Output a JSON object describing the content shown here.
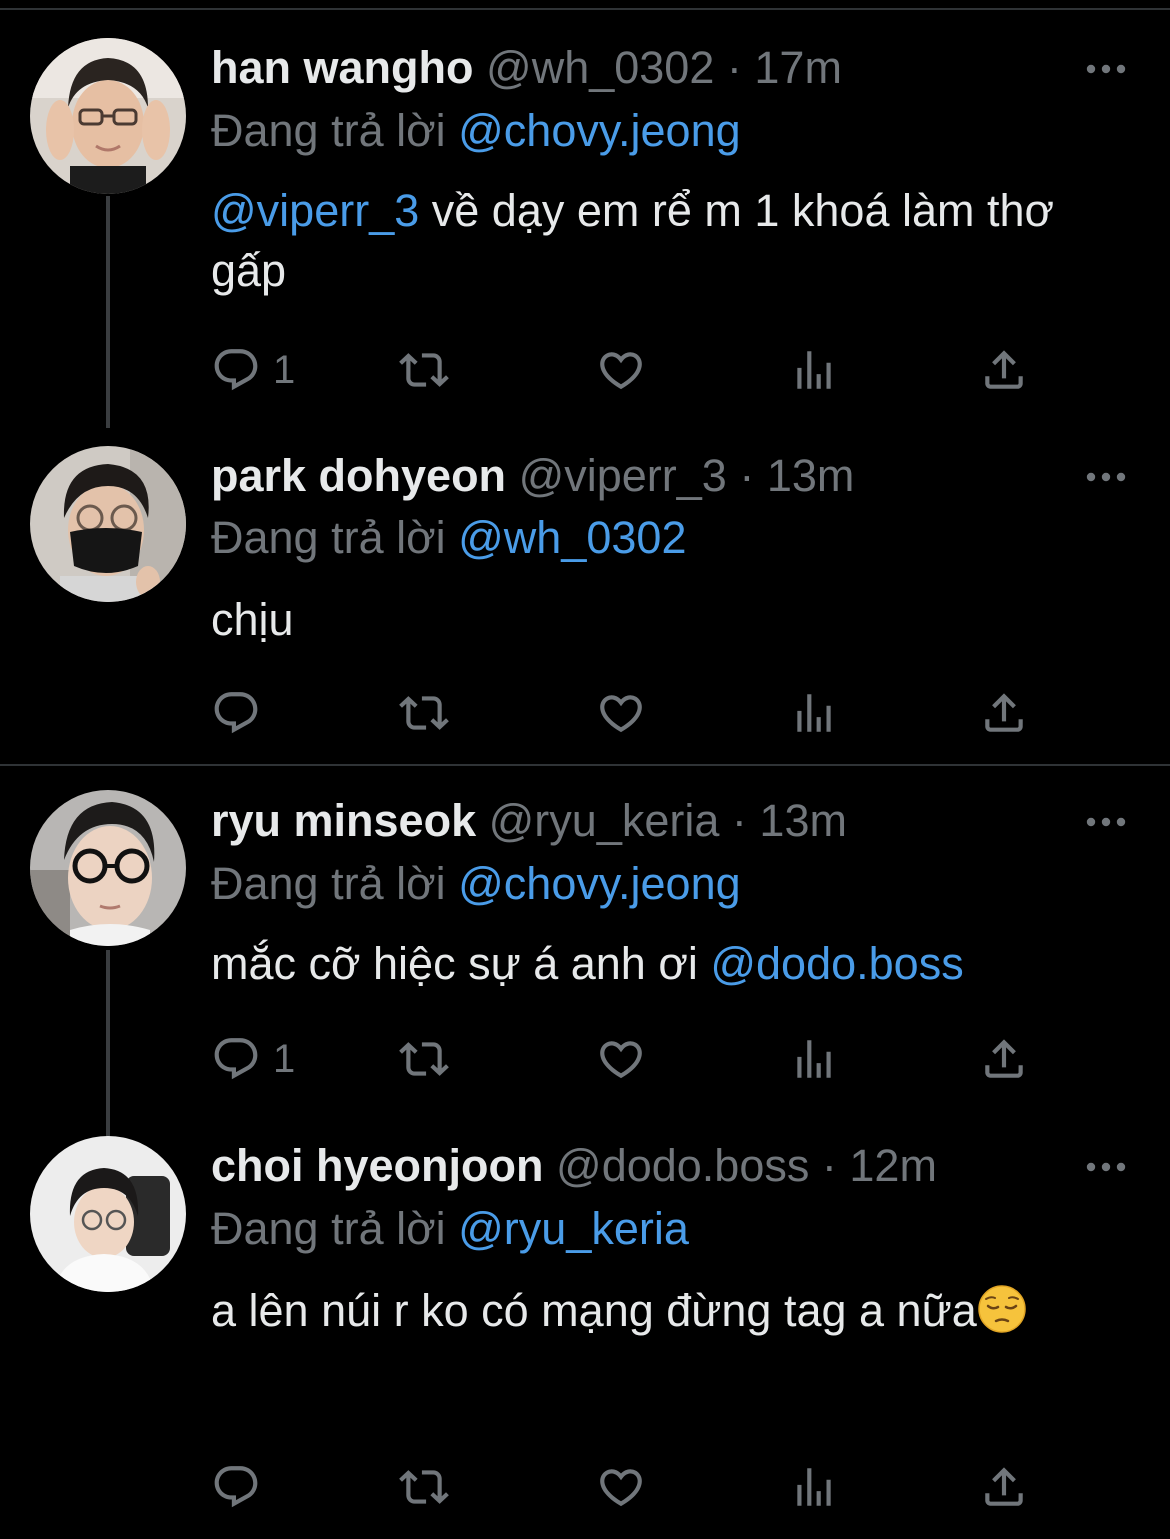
{
  "thread1": {
    "tweets": [
      {
        "display_name": "han wangho",
        "handle": "@wh_0302",
        "separator": "·",
        "time": "17m",
        "reply_prefix": "Đang trả lời",
        "reply_to": "@chovy.jeong",
        "body_mention": "@viperr_3",
        "body_text": " về dạy em rể m 1 khoá làm thơ gấp",
        "reply_count": "1",
        "avatar_icon": "avatar-han-wangho"
      },
      {
        "display_name": "park dohyeon",
        "handle": "@viperr_3",
        "separator": "·",
        "time": "13m",
        "reply_prefix": "Đang trả lời",
        "reply_to": "@wh_0302",
        "body_text": "chịu",
        "reply_count": "",
        "avatar_icon": "avatar-park-dohyeon"
      }
    ]
  },
  "thread2": {
    "tweets": [
      {
        "display_name": "ryu minseok",
        "handle": "@ryu_keria",
        "separator": "·",
        "time": "13m",
        "reply_prefix": "Đang trả lời",
        "reply_to": "@chovy.jeong",
        "body_text": "mắc cỡ hiệc sự á anh ơi ",
        "body_mention": "@dodo.boss",
        "reply_count": "1",
        "avatar_icon": "avatar-ryu-minseok"
      },
      {
        "display_name": "choi hyeonjoon",
        "handle": "@dodo.boss",
        "separator": "·",
        "time": "12m",
        "reply_prefix": "Đang trả lời",
        "reply_to": "@ryu_keria",
        "body_text": "a lên núi r ko có mạng đừng tag a nữa",
        "body_emoji": "pensive-face-emoji",
        "reply_count": "",
        "avatar_icon": "avatar-choi-hyeonjoon"
      }
    ]
  },
  "icons": {
    "reply": "reply-icon",
    "retweet": "retweet-icon",
    "like": "heart-icon",
    "views": "views-icon",
    "share": "share-icon",
    "more": "more-options-icon"
  },
  "colors": {
    "background": "#000000",
    "primary_text": "#e7e9ea",
    "secondary_text": "#71767b",
    "mention": "#4a9ce8",
    "divider": "#2f3336",
    "thread_line": "#3a3d40"
  }
}
